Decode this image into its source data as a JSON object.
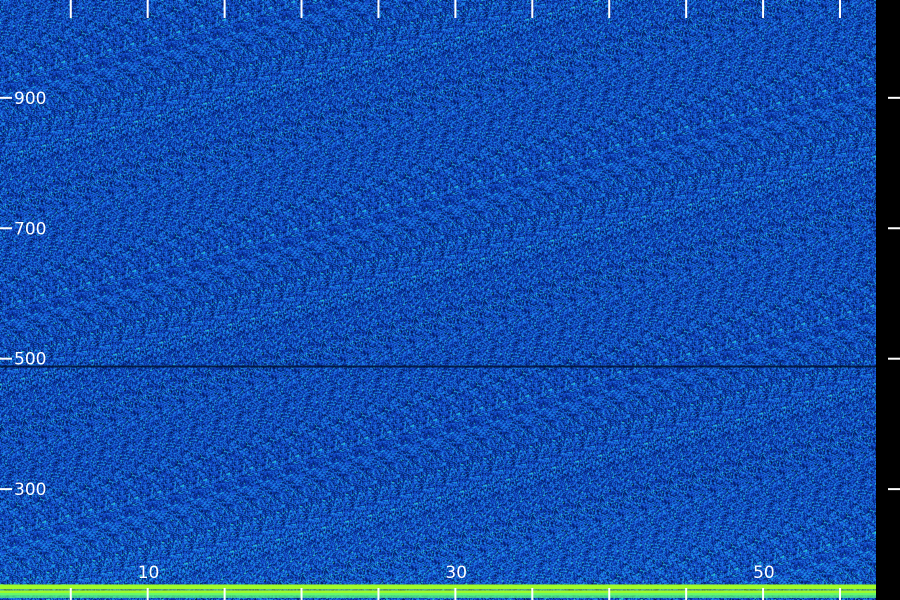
{
  "chart_data": {
    "type": "heatmap",
    "title": "",
    "xlabel": "",
    "ylabel": "",
    "x_tick_labels": [
      "10",
      "30",
      "50"
    ],
    "y_tick_labels": [
      "900",
      "700",
      "500",
      "300"
    ],
    "x_ticks": [
      5,
      10,
      15,
      20,
      25,
      30,
      35,
      40,
      45,
      50,
      55
    ],
    "y_ticks": [
      300,
      500,
      700,
      900
    ],
    "xlim": [
      0.4,
      58.9
    ],
    "ylim": [
      130,
      1050
    ],
    "colormap": [
      "#000000",
      "#001a5e",
      "#0a35a8",
      "#1e64e6",
      "#19b9f0",
      "#3cf0b4",
      "#7dff2d",
      "#c8ff1e"
    ],
    "background_color": "#000000",
    "tick_color": "#ffffff",
    "features": [
      {
        "kind": "horizontal_band",
        "y": 150,
        "intensity": 0.95
      },
      {
        "kind": "horizontal_band",
        "y": 141,
        "intensity": 0.95
      },
      {
        "kind": "horizontal_band",
        "y": 137,
        "intensity": 0.55
      },
      {
        "kind": "horizontal_dark_line",
        "y": 488
      }
    ],
    "grid": false,
    "legend": "none"
  }
}
